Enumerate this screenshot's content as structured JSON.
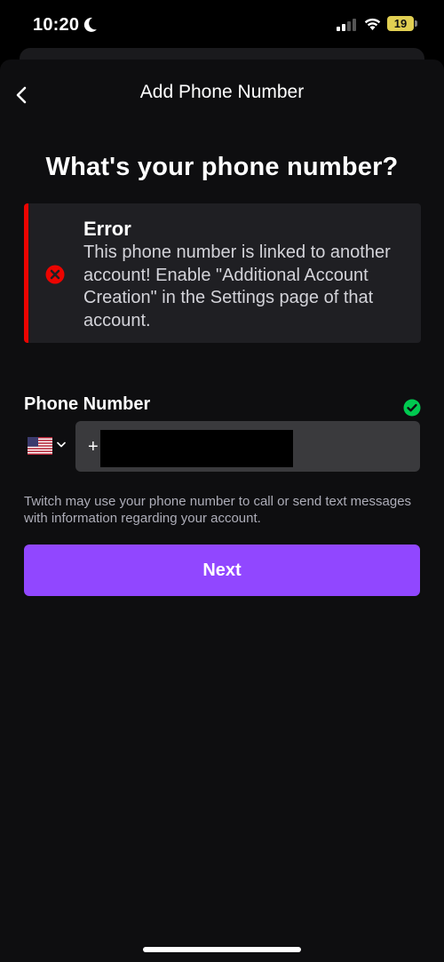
{
  "status_bar": {
    "time": "10:20",
    "battery": "19",
    "icons": [
      "moon-icon",
      "signal-icon",
      "wifi-icon",
      "battery-icon"
    ]
  },
  "header": {
    "title": "Add Phone Number",
    "back_icon": "chevron-left-icon"
  },
  "heading": "What's your phone number?",
  "error": {
    "title": "Error",
    "message": "This phone number is linked to another account! Enable \"Additional Account Creation\" in the Settings page of that account.",
    "icon": "error-circle-icon",
    "accent_color": "#eb0400"
  },
  "phone": {
    "label": "Phone Number",
    "country_flag": "us-flag-icon",
    "prefix": "+",
    "value": "",
    "valid_icon": "check-circle-icon",
    "valid_color": "#00c950"
  },
  "disclaimer": "Twitch may use your phone number to call or send text messages with information regarding your account.",
  "next_button": {
    "label": "Next",
    "color": "#9147ff"
  }
}
